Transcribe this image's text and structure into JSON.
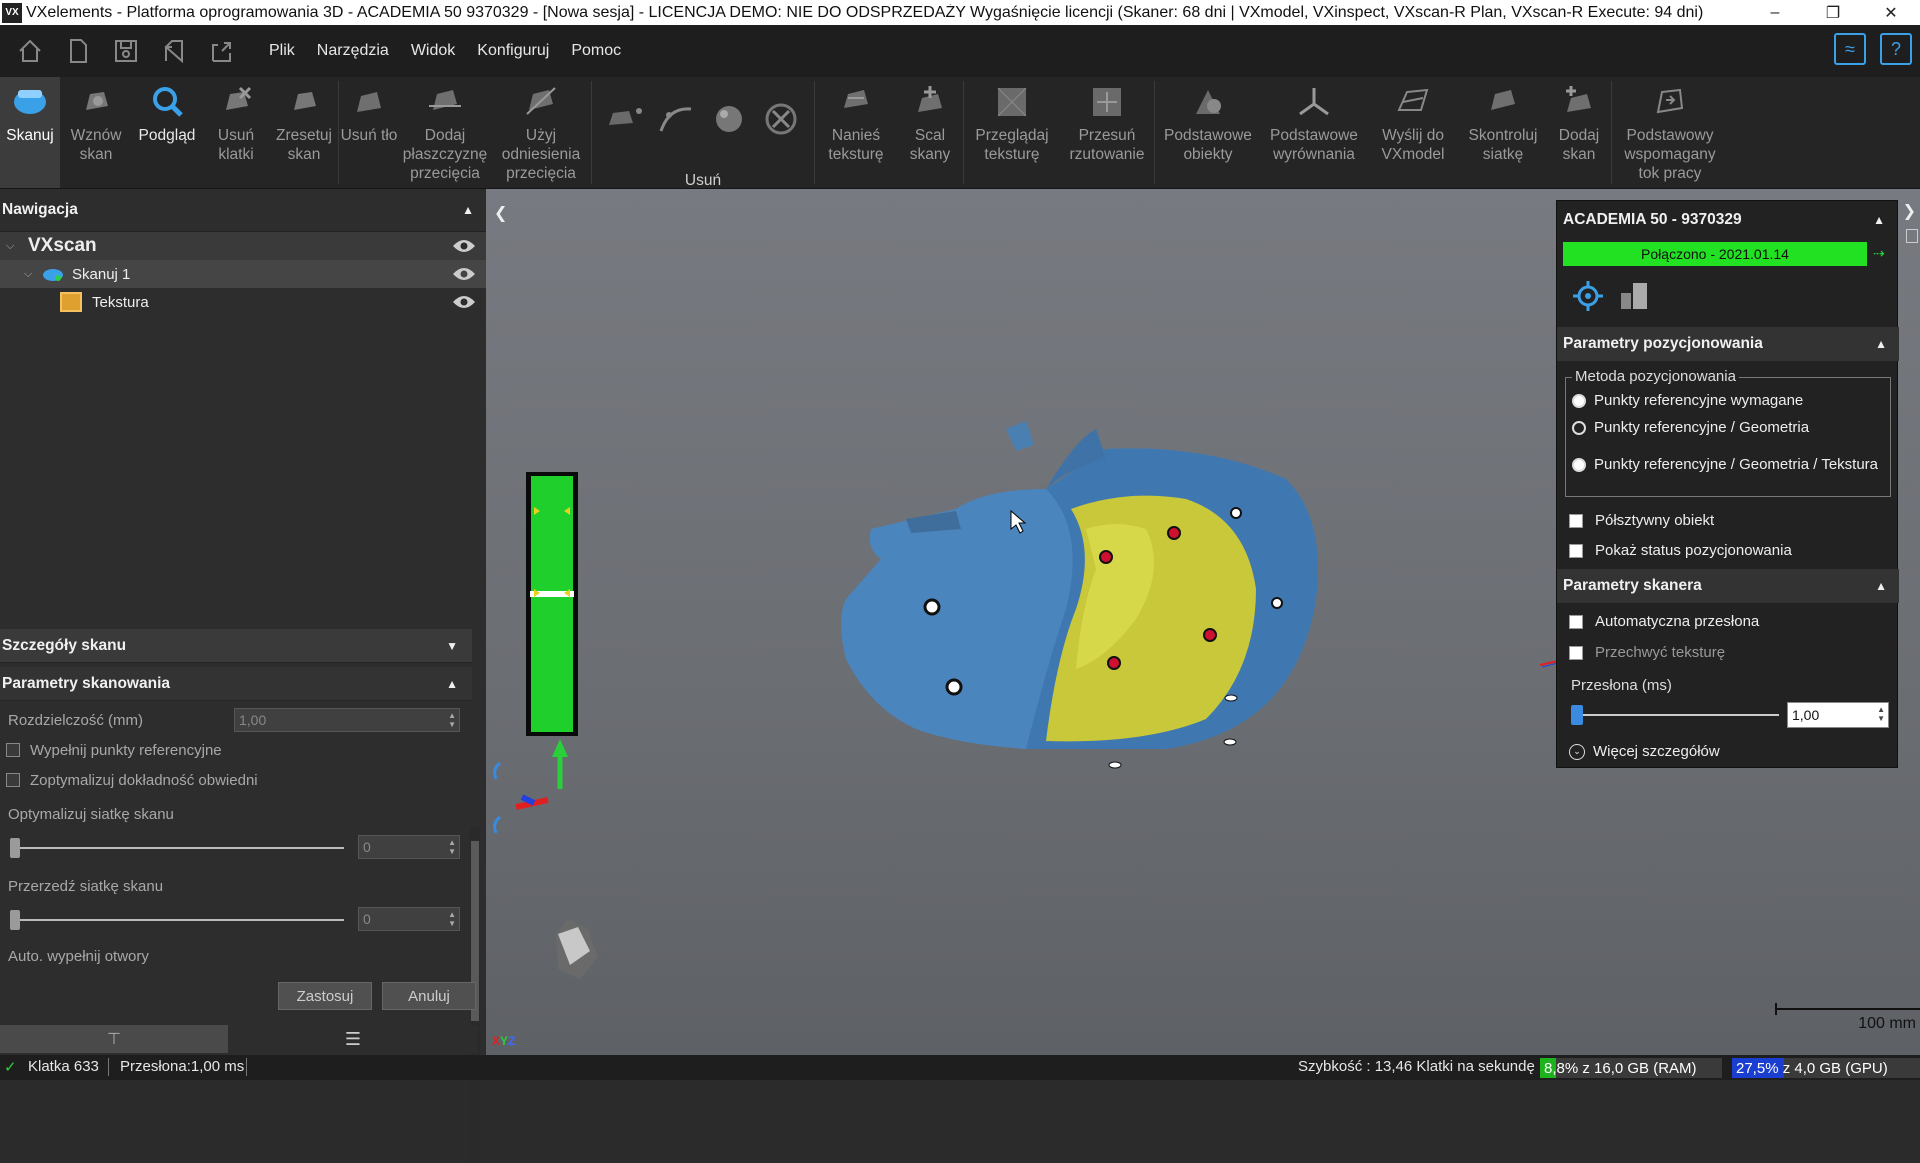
{
  "window": {
    "title": "VXelements - Platforma oprogramowania 3D - ACADEMIA 50 9370329 - [Nowa sesja] - LICENCJA DEMO: NIE DO ODSPRZEDAŻY Wygaśnięcie licencji (Skaner: 68 dni | VXmodel, VXinspect, VXscan-R Plan, VXscan-R Execute: 94 dni)",
    "logo": "VX"
  },
  "menu": {
    "items": [
      "Plik",
      "Narzędzia",
      "Widok",
      "Konfiguruj",
      "Pomoc"
    ],
    "quick_icons": [
      "home-icon",
      "new-file-icon",
      "save-icon",
      "open-project-icon",
      "export-icon"
    ]
  },
  "ribbon": {
    "skanuj": "Skanuj",
    "wznow": "Wznów skan",
    "podglad": "Podgląd",
    "usun_klatki": "Usuń klatki",
    "zresetuj": "Zresetuj skan",
    "usun_tlo": "Usuń tło",
    "dodaj_plaszczyzne": "Dodaj płaszczyznę przecięcia",
    "uzyj_odniesienia": "Użyj odniesienia przecięcia",
    "usun_group": "Usuń",
    "nanies": "Nanieś teksturę",
    "scal": "Scal skany",
    "przegladaj": "Przeglądaj teksturę",
    "przesun": "Przesuń rzutowanie",
    "podstawowe_obiekty": "Podstawowe obiekty",
    "podstawowe_wyrownania": "Podstawowe wyrównania",
    "wyslij": "Wyślij do VXmodel",
    "skontroluj": "Skontroluj siatkę",
    "dodaj_skan": "Dodaj skan",
    "podstawowy_tok": "Podstawowy wspomagany tok pracy"
  },
  "nav": {
    "header": "Nawigacja",
    "root": "VXscan",
    "scan": "Skanuj 1",
    "texture": "Tekstura"
  },
  "details": {
    "header": "Szczegóły skanu",
    "params_header": "Parametry skanowania",
    "resolution_label": "Rozdzielczość (mm)",
    "resolution_value": "1,00",
    "fill_targets": "Wypełnij punkty referencyjne",
    "optimize_accuracy": "Zoptymalizuj dokładność obwiedni",
    "optimize_mesh": "Optymalizuj siatkę skanu",
    "optimize_mesh_value": "0",
    "decimate_mesh": "Przerzedź siatkę skanu",
    "decimate_mesh_value": "0",
    "auto_fill": "Auto. wypełnij otwory",
    "apply": "Zastosuj",
    "cancel": "Anuluj"
  },
  "scanner_panel": {
    "device": "ACADEMIA 50 - 9370329",
    "connection": "Połączono - 2021.01.14",
    "positioning_header": "Parametry pozycjonowania",
    "method_legend": "Metoda pozycjonowania",
    "method_options": [
      "Punkty referencyjne wymagane",
      "Punkty referencyjne / Geometria",
      "Punkty referencyjne / Geometria / Tekstura"
    ],
    "semi_rigid": "Półsztywny obiekt",
    "show_status": "Pokaż status pozycjonowania",
    "scanner_header": "Parametry skanera",
    "auto_shutter": "Automatyczna przesłona",
    "capture_texture": "Przechwyć teksturę",
    "shutter_label": "Przesłona (ms)",
    "shutter_value": "1,00",
    "more_details": "Więcej szczegółów"
  },
  "viewport": {
    "scale_label": "100 mm",
    "axis_label_x": "X",
    "axis_label_y": "Y",
    "axis_label_z": "Z"
  },
  "status": {
    "frame": "Klatka 633",
    "shutter": "Przesłona:1,00 ms",
    "speed": "Szybkość : 13,46 Klatki na sekundę",
    "ram": "8,8% z 16,0 GB (RAM)",
    "ram_fraction": 0.088,
    "gpu": "27,5% z 4,0 GB (GPU)",
    "gpu_fraction": 0.275
  },
  "colors": {
    "accent_blue": "#3aa0e8",
    "connected_green": "#22e022",
    "scan_blue": "#4a88c2",
    "texture_yellow": "#c8c83a"
  }
}
